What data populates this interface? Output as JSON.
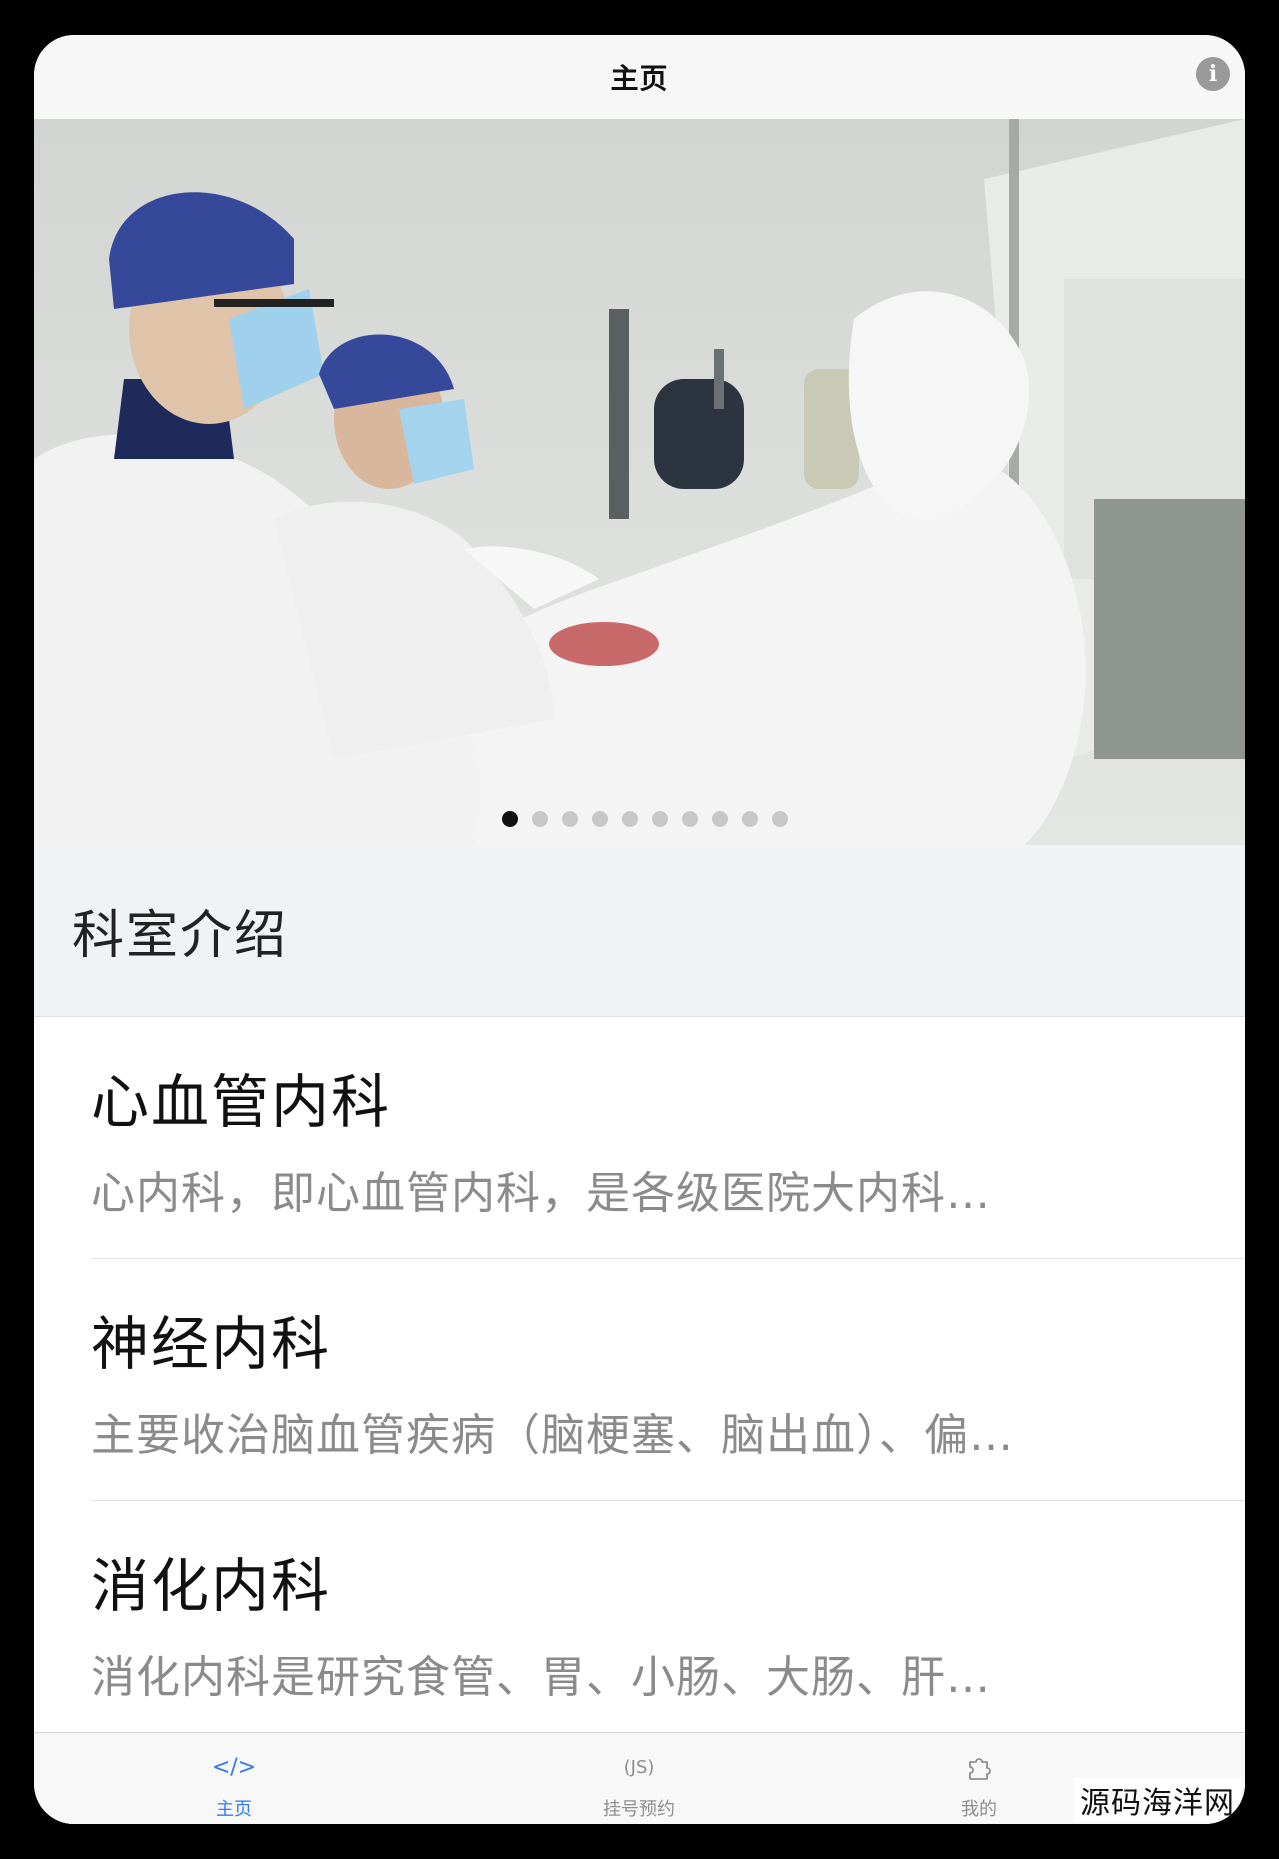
{
  "navbar": {
    "title": "主页"
  },
  "banner": {
    "slide_count": 10,
    "active_index": 0
  },
  "section": {
    "title": "科室介绍"
  },
  "departments": [
    {
      "title": "心血管内科",
      "desc": "心内科，即心血管内科，是各级医院大内科…"
    },
    {
      "title": "神经内科",
      "desc": "主要收治脑血管疾病（脑梗塞、脑出血）、偏…"
    },
    {
      "title": "消化内科",
      "desc": "消化内科是研究食管、胃、小肠、大肠、肝…"
    }
  ],
  "tabbar": {
    "items": [
      {
        "label": "主页",
        "icon": "code-icon",
        "glyph": "</>",
        "active": true
      },
      {
        "label": "挂号预约",
        "icon": "js-icon",
        "glyph": "(JS)",
        "active": false
      },
      {
        "label": "我的",
        "icon": "puzzle-icon",
        "glyph": "",
        "active": false
      }
    ]
  },
  "watermark": "源码海洋网",
  "colors": {
    "accent": "#3478f6",
    "section_bg": "#eff3f4",
    "desc_text": "#8b8b8b"
  }
}
